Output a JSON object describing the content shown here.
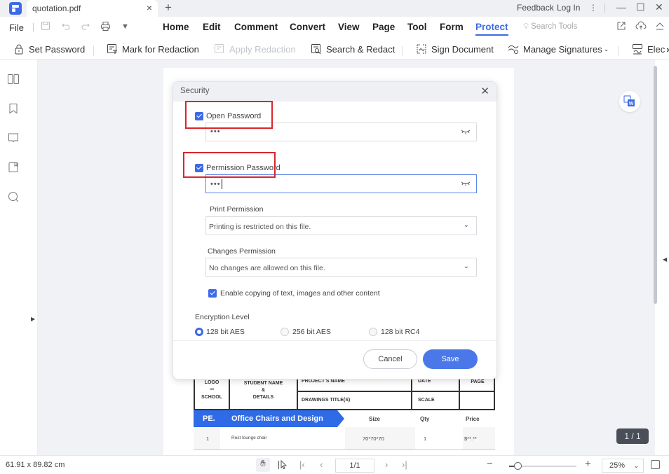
{
  "titlebar": {
    "tab_title": "quotation.pdf",
    "tab_close": "×",
    "new_tab": "+",
    "feedback": "Feedback",
    "login": "Log In",
    "more": "⋮",
    "minimize": "—",
    "maximize": "☐",
    "close": "✕"
  },
  "menubar": {
    "file": "File",
    "items": [
      "Home",
      "Edit",
      "Comment",
      "Convert",
      "View",
      "Page",
      "Tool",
      "Form",
      "Protect"
    ],
    "active": "Protect",
    "search_tools": "Search Tools"
  },
  "ribbon": {
    "items": [
      {
        "label": "Set Password",
        "icon": "lock-icon",
        "enabled": true
      },
      {
        "label": "Mark for Redaction",
        "icon": "mark-redaction-icon",
        "enabled": true
      },
      {
        "label": "Apply Redaction",
        "icon": "apply-redaction-icon",
        "enabled": false
      },
      {
        "label": "Search & Redact",
        "icon": "search-redact-icon",
        "enabled": true
      },
      {
        "label": "Sign Document",
        "icon": "sign-document-icon",
        "enabled": true
      },
      {
        "label": "Manage Signatures",
        "icon": "manage-signatures-icon",
        "enabled": true
      },
      {
        "label": "Elec",
        "icon": "electronic-signature-icon",
        "enabled": true
      }
    ],
    "overflow": "›"
  },
  "sidebar": {
    "items": [
      "thumbnails-icon",
      "bookmark-icon",
      "comment-icon",
      "attachment-icon",
      "search-icon"
    ]
  },
  "dialog": {
    "title": "Security",
    "open_password": {
      "label": "Open Password",
      "checked": true,
      "value": "•••"
    },
    "permission_password": {
      "label": "Permission Password",
      "checked": true,
      "value": "•••"
    },
    "print_permission": {
      "label": "Print Permission",
      "value": "Printing is restricted on this file."
    },
    "changes_permission": {
      "label": "Changes Permission",
      "value": "No changes are allowed on this file."
    },
    "enable_copying": {
      "label": "Enable copying of text, images and other content",
      "checked": true
    },
    "encryption": {
      "label": "Encryption Level",
      "options": [
        "128 bit AES",
        "256 bit AES",
        "128 bit RC4"
      ],
      "selected": "128 bit AES"
    },
    "cancel": "Cancel",
    "save": "Save"
  },
  "pdf": {
    "header": {
      "logo": "LOGO",
      "or": "OR",
      "school": "SCHOOL",
      "student_name": "STUDENT NAME",
      "amp": "&",
      "details": "DETAILS",
      "project_name": "PROJECT'S NAME",
      "drawings_title": "DRAWINGS TITLE(S)",
      "date": "DATE",
      "scale": "SCALE",
      "page": "PAGE"
    },
    "banner": {
      "code": "PE.",
      "title": "Office Chairs and Design"
    },
    "columns": [
      "Size",
      "Qty",
      "Price"
    ],
    "rows": [
      {
        "no": "1",
        "item": "Rest lounge chair",
        "size": "70*70*70",
        "qty": "1",
        "price": "$**.**"
      }
    ]
  },
  "page_badge": "1 / 1",
  "statusbar": {
    "dimensions": "61.91 x 89.82 cm",
    "page_input": "1/1",
    "zoom_value": "25%",
    "zoom_fraction": 0.12
  },
  "colors": {
    "accent": "#3d6ae6",
    "highlight": "#d9262c",
    "banner": "#2f6be6"
  }
}
